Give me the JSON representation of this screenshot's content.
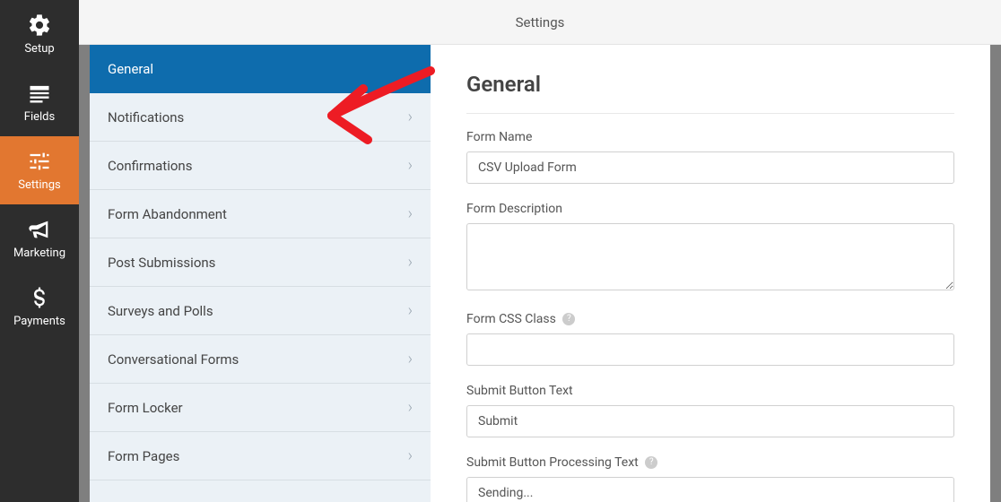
{
  "topbar": {
    "title": "Settings"
  },
  "navrail": {
    "items": [
      {
        "label": "Setup"
      },
      {
        "label": "Fields"
      },
      {
        "label": "Settings"
      },
      {
        "label": "Marketing"
      },
      {
        "label": "Payments"
      }
    ]
  },
  "submenu": {
    "items": [
      {
        "label": "General"
      },
      {
        "label": "Notifications"
      },
      {
        "label": "Confirmations"
      },
      {
        "label": "Form Abandonment"
      },
      {
        "label": "Post Submissions"
      },
      {
        "label": "Surveys and Polls"
      },
      {
        "label": "Conversational Forms"
      },
      {
        "label": "Form Locker"
      },
      {
        "label": "Form Pages"
      }
    ]
  },
  "panel": {
    "heading": "General",
    "fields": {
      "form_name": {
        "label": "Form Name",
        "value": "CSV Upload Form"
      },
      "form_description": {
        "label": "Form Description",
        "value": ""
      },
      "form_css_class": {
        "label": "Form CSS Class",
        "value": ""
      },
      "submit_button_text": {
        "label": "Submit Button Text",
        "value": "Submit"
      },
      "submit_button_processing_text": {
        "label": "Submit Button Processing Text",
        "value": "Sending..."
      }
    }
  },
  "annotation": {
    "color": "#ed1c24"
  }
}
